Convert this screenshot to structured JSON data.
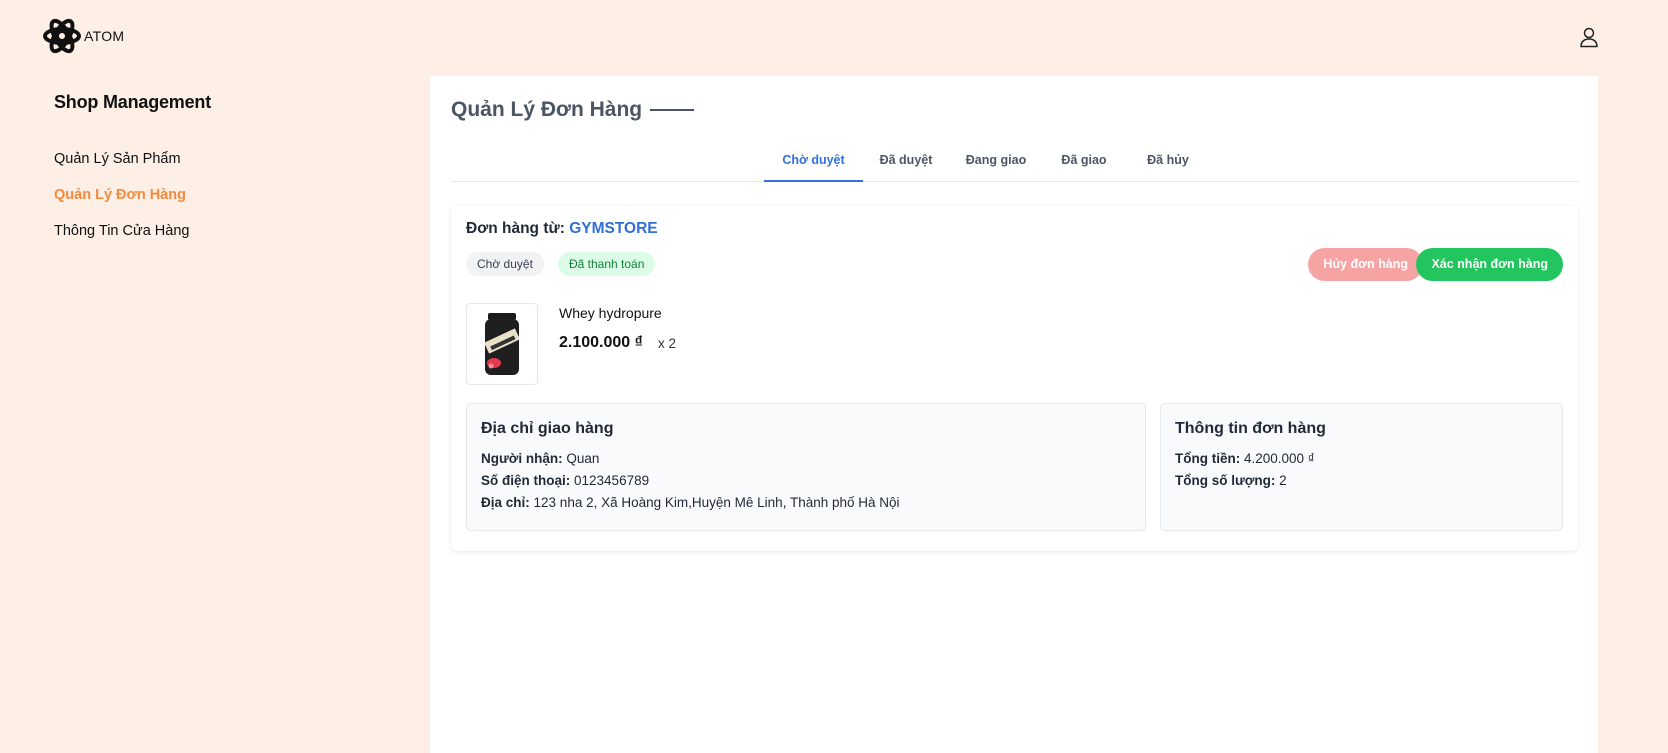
{
  "header": {
    "logo_text": "ATOM",
    "logo_icon": "atom-icon",
    "user_icon": "user-icon"
  },
  "sidebar": {
    "title": "Shop Management",
    "items": [
      {
        "label": "Quản Lý Sản Phẩm",
        "active": false
      },
      {
        "label": "Quản Lý Đơn Hàng",
        "active": true
      },
      {
        "label": "Thông Tin Cửa Hàng",
        "active": false
      }
    ]
  },
  "main": {
    "title": "Quản Lý Đơn Hàng",
    "tabs": [
      {
        "label": "Chờ duyệt",
        "active": true
      },
      {
        "label": "Đã duyệt",
        "active": false
      },
      {
        "label": "Đang giao",
        "active": false
      },
      {
        "label": "Đã giao",
        "active": false
      },
      {
        "label": "Đã hủy",
        "active": false
      }
    ]
  },
  "order": {
    "from_label": "Đơn hàng từ:",
    "store_name": "GYMSTORE",
    "status_badge": "Chờ duyệt",
    "payment_badge": "Đã thanh toán",
    "cancel_button": "Hủy đơn hàng",
    "confirm_button": "Xác nhận đơn hàng",
    "product": {
      "name": "Whey hydropure",
      "price": "2.100.000 ₫",
      "quantity": "x 2"
    },
    "address": {
      "title": "Địa chỉ giao hàng",
      "recipient_label": "Người nhận:",
      "recipient": "Quan",
      "phone_label": "Số điện thoại:",
      "phone": "0123456789",
      "address_label": "Địa chỉ:",
      "address": "123 nha 2, Xã Hoàng Kim,Huyện Mê Linh, Thành phố Hà Nội"
    },
    "summary": {
      "title": "Thông tin đơn hàng",
      "total_label": "Tổng tiền:",
      "total": "4.200.000 ₫",
      "count_label": "Tổng số lượng:",
      "count": "2"
    }
  },
  "colors": {
    "page_bg": "#fdefe6",
    "accent_orange": "#f58a3c",
    "tab_active": "#2f73e0",
    "store_blue": "#2f6fd6",
    "confirm_green": "#22c55e",
    "cancel_red": "#f6a3a3"
  }
}
